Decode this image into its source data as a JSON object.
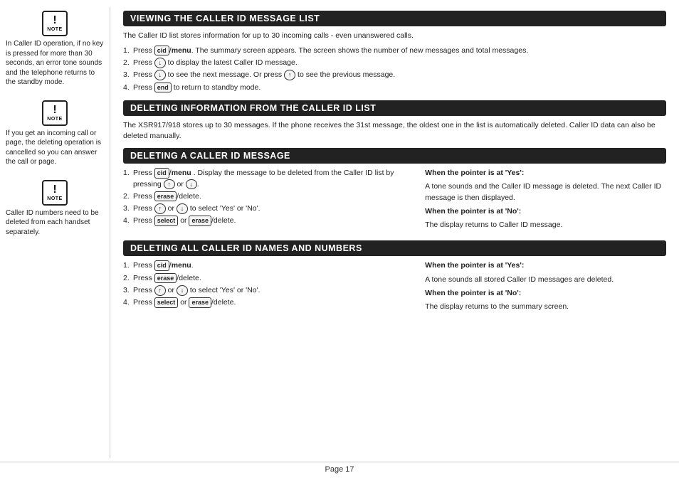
{
  "sidebar": {
    "notes": [
      {
        "id": "note1",
        "icon_label": "NOTE",
        "text": "In Caller ID operation, if no key is pressed for more than 30 seconds, an error tone sounds and the telephone returns to the standby mode."
      },
      {
        "id": "note2",
        "icon_label": "NOTE",
        "text": "If you get an incoming call or page, the deleting operation is cancelled so you can answer the call or page."
      },
      {
        "id": "note3",
        "icon_label": "NOTE",
        "text": "Caller ID numbers need to be deleted from each handset separately."
      }
    ]
  },
  "sections": {
    "viewing": {
      "title": "VIEWING THE CALLER ID MESSAGE LIST",
      "intro": "The Caller ID list stores information for up to 30 incoming calls - even unanswered calls.",
      "steps": [
        "Press  /menu . The summary screen appears. The screen shows the number of new messages and total messages.",
        "Press   to display the latest Caller ID message.",
        "Press   to see the next message. Or press   to see the previous message.",
        "Press   to return to standby mode."
      ]
    },
    "deleting_info": {
      "title": "DELETING INFORMATION FROM THE CALLER ID LIST",
      "text": "The XSR917/918 stores up to 30 messages. If the phone receives the 31st message, the oldest one in the list is automatically deleted. Caller ID data can also be deleted manually."
    },
    "deleting_message": {
      "title": "DELETING A CALLER ID MESSAGE",
      "steps": [
        "Press  /menu . Display the message to be deleted from the Caller ID list by pressing   or  .",
        "Press  /delete.",
        "Press   or   to select 'Yes' or 'No'.",
        "Press   or  /delete."
      ],
      "right": {
        "when_yes_label": "When the pointer is at 'Yes':",
        "when_yes_text": "A tone sounds and the Caller ID message is deleted. The next Caller ID message is then displayed.",
        "when_no_label": "When the pointer is at 'No':",
        "when_no_text": "The display returns to Caller ID message."
      }
    },
    "deleting_all": {
      "title": "DELETING ALL CALLER ID NAMES AND NUMBERS",
      "steps": [
        "Press  /menu.",
        "Press  /delete.",
        "Press   or   to select 'Yes' or 'No'.",
        "Press   or  /delete."
      ],
      "right": {
        "when_yes_label": "When the pointer is at 'Yes':",
        "when_yes_text": "A tone sounds all stored Caller ID messages are deleted.",
        "when_no_label": "When the pointer is at 'No':",
        "when_no_text": "The display returns to the summary screen."
      }
    }
  },
  "footer": {
    "page_label": "Page 17"
  }
}
